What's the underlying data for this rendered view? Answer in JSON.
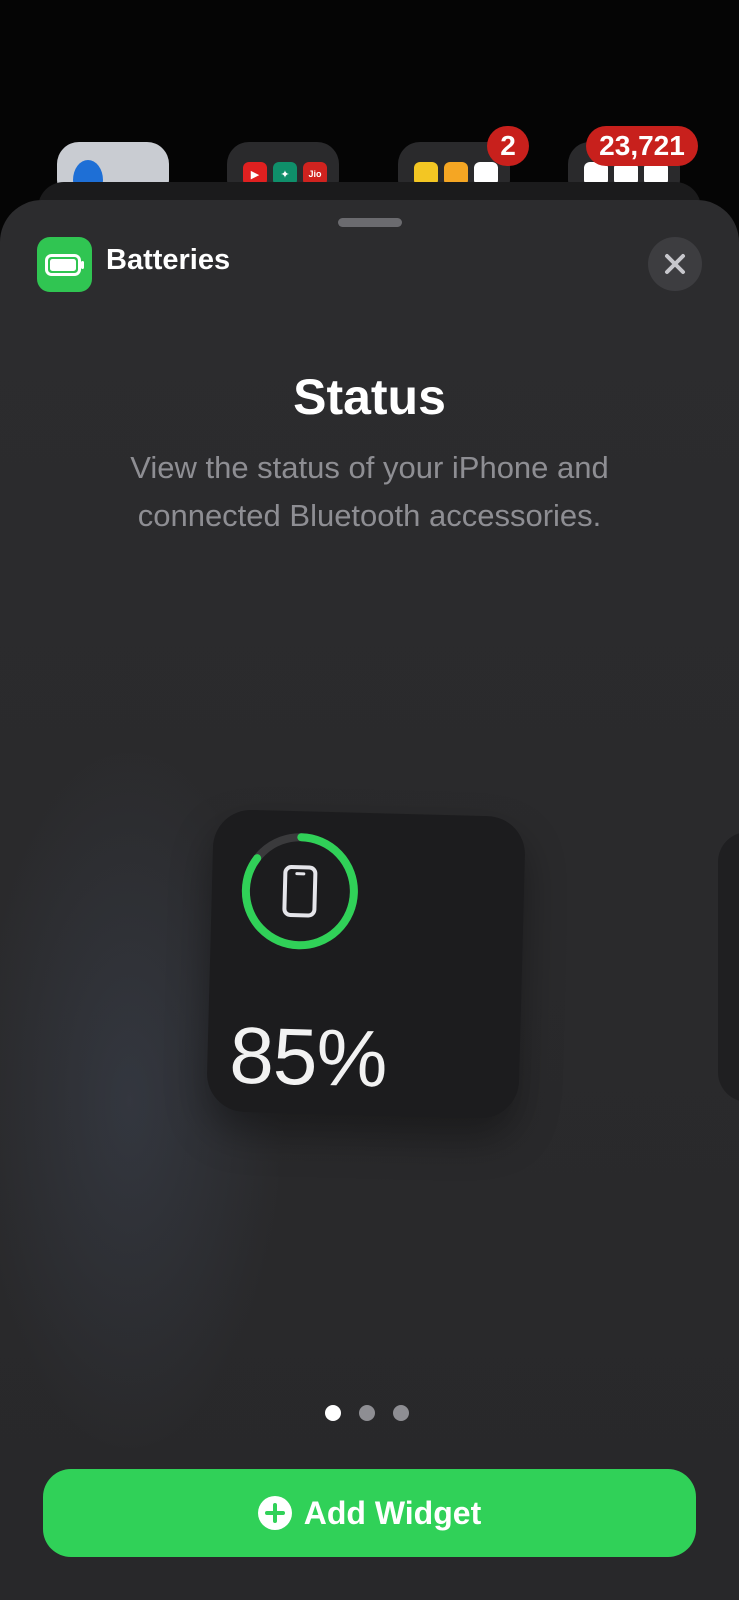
{
  "background": {
    "badges": {
      "folder3": "2",
      "folder4": "23,721"
    },
    "mini_icons": {
      "jio": "Jio"
    }
  },
  "sheet": {
    "app_name": "Batteries",
    "app_icon": "battery-icon",
    "close_icon": "close-icon",
    "title": "Status",
    "description": "View the status of your iPhone and connected Bluetooth accessories."
  },
  "widget": {
    "device_icon": "iphone-icon",
    "percent_label": "85%",
    "battery_level": 0.85,
    "ring_color": "#30d158"
  },
  "pagination": {
    "count": 3,
    "active_index": 0
  },
  "add_button": {
    "label": "Add Widget",
    "icon": "plus-circle-icon",
    "color": "#30d158"
  }
}
